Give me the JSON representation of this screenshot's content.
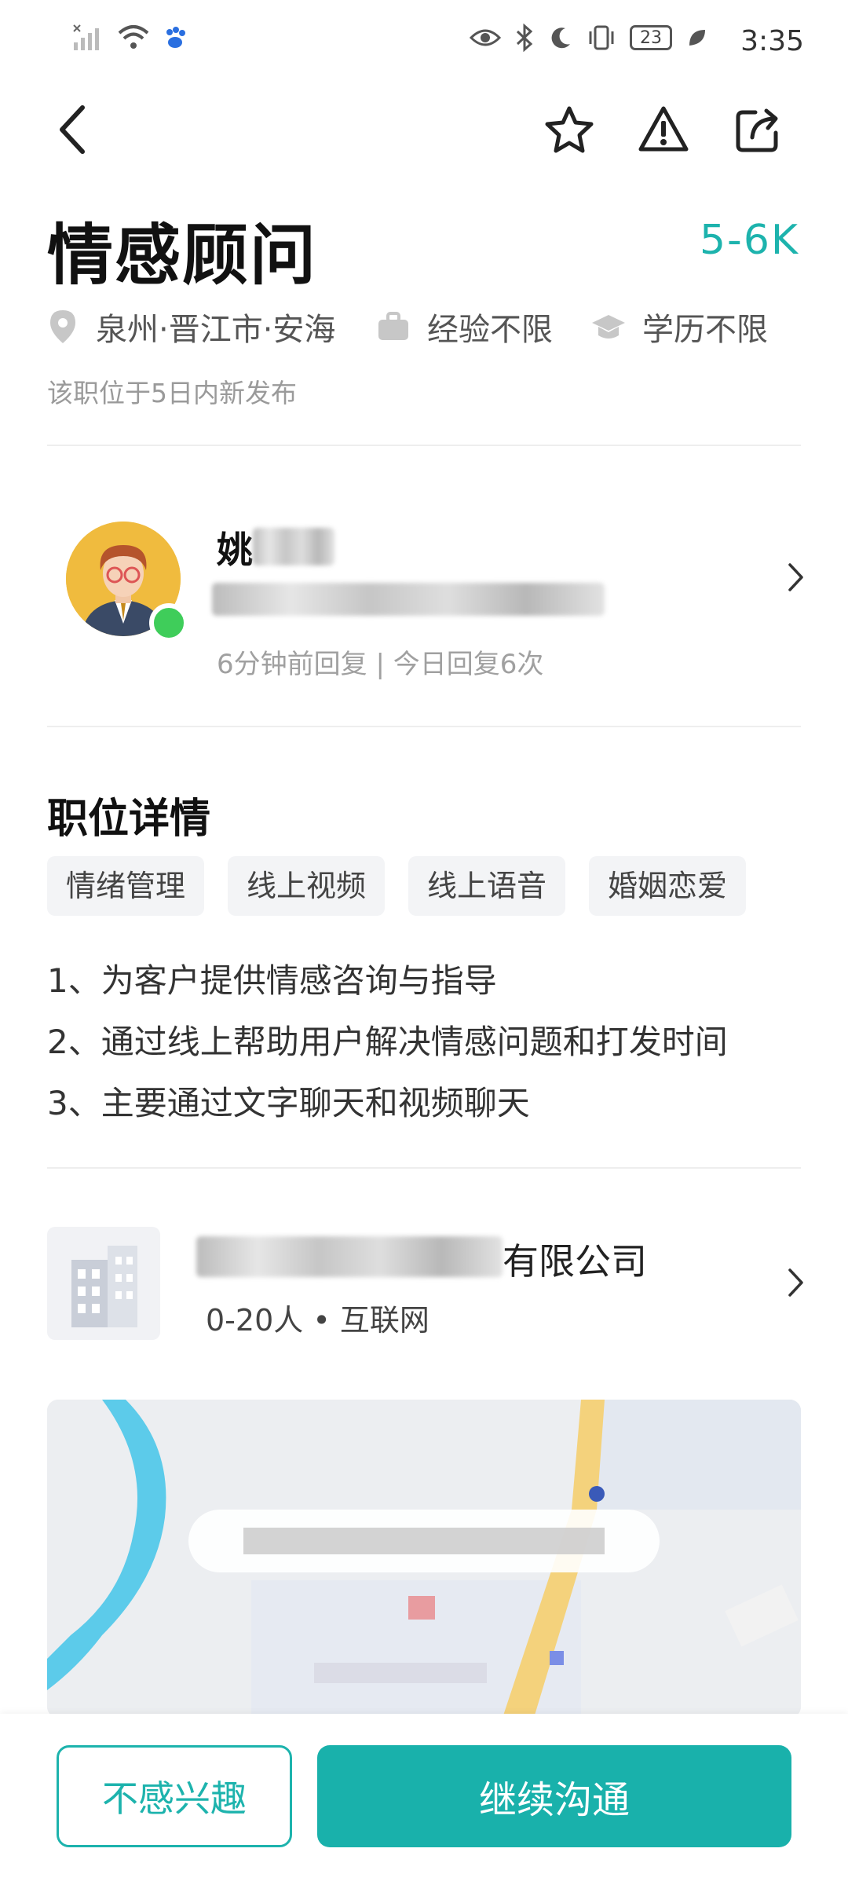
{
  "status_bar": {
    "battery": "23",
    "time": "3:35"
  },
  "nav": {
    "back_icon": "back-arrow-icon",
    "actions": [
      "star-icon",
      "report-icon",
      "share-icon"
    ]
  },
  "job": {
    "title": "情感顾问",
    "salary": "5-6K",
    "location": "泉州·晋江市·安海",
    "experience": "经验不限",
    "education": "学历不限",
    "posted": "该职位于5日内新发布"
  },
  "recruiter": {
    "name_visible": "姚",
    "reply_info": "6分钟前回复 | 今日回复6次"
  },
  "details": {
    "heading": "职位详情",
    "tags": [
      "情绪管理",
      "线上视频",
      "线上语音",
      "婚姻恋爱"
    ],
    "lines": [
      "1、为客户提供情感咨询与指导",
      "2、通过线上帮助用户解决情感问题和打发时间",
      "3、主要通过文字聊天和视频聊天"
    ]
  },
  "company": {
    "name_suffix": "有限公司",
    "info": "0-20人 • 互联网"
  },
  "actions": {
    "not_interested": "不感兴趣",
    "continue_chat": "继续沟通"
  },
  "colors": {
    "accent": "#1db3ad",
    "online": "#3fcd5a"
  }
}
